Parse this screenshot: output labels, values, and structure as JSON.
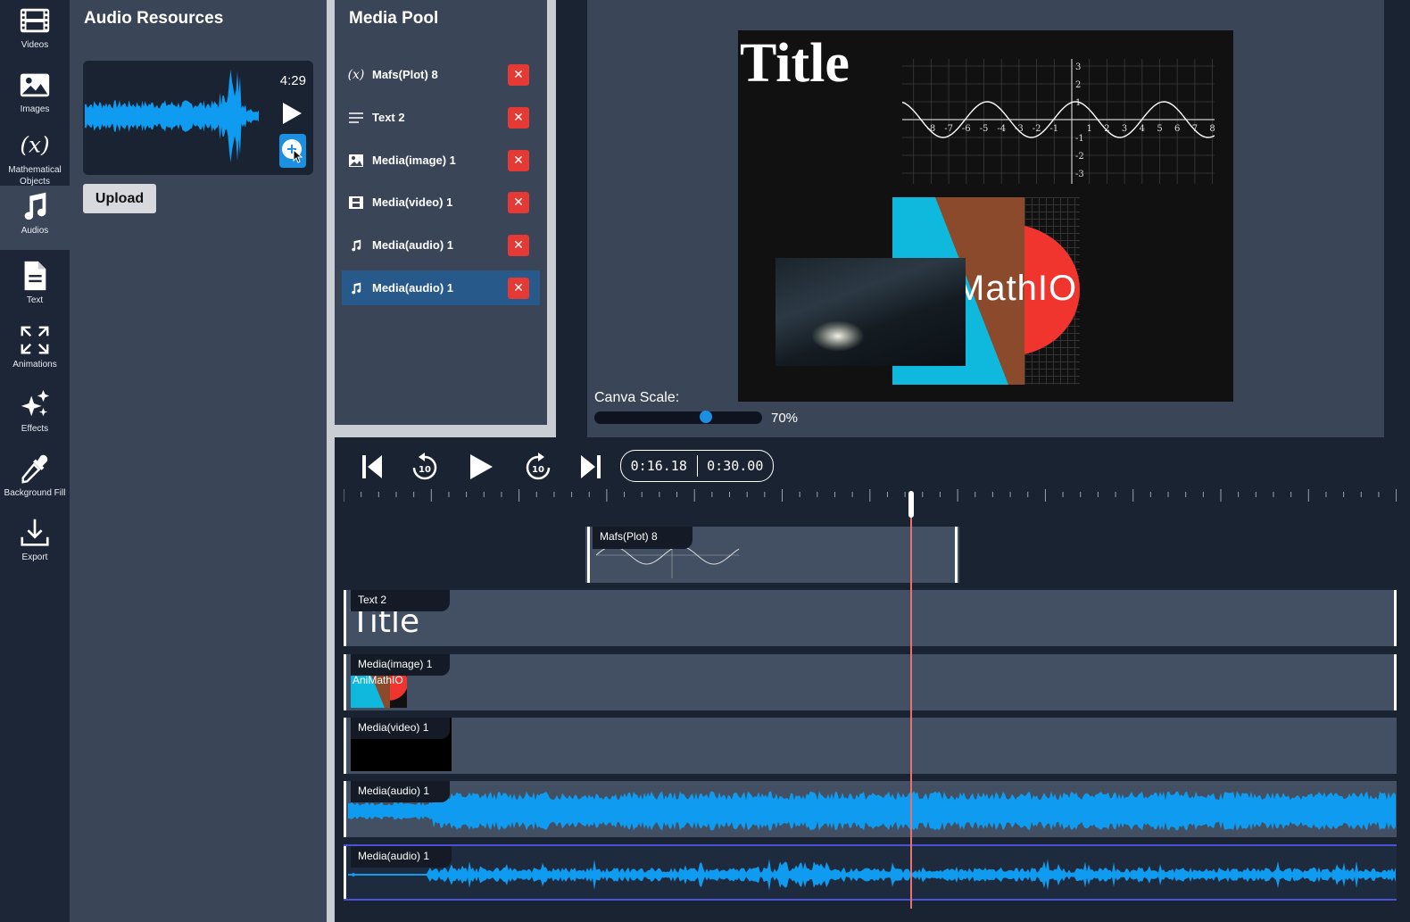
{
  "sidebar": {
    "items": [
      {
        "label": "Videos",
        "icon": "film-icon"
      },
      {
        "label": "Images",
        "icon": "image-icon"
      },
      {
        "label": "Mathematical Objects",
        "icon": "function-icon"
      },
      {
        "label": "Audios",
        "icon": "music-note-icon",
        "active": true
      },
      {
        "label": "Text",
        "icon": "document-icon"
      },
      {
        "label": "Animations",
        "icon": "expand-arrows-icon"
      },
      {
        "label": "Effects",
        "icon": "sparkles-icon"
      },
      {
        "label": "Background Fill",
        "icon": "eyedropper-icon"
      },
      {
        "label": "Export",
        "icon": "download-icon"
      }
    ]
  },
  "audio_resources": {
    "title": "Audio Resources",
    "card": {
      "duration": "4:29"
    },
    "upload_label": "Upload"
  },
  "media_pool": {
    "title": "Media Pool",
    "items": [
      {
        "label": "Mafs(Plot) 8",
        "icon": "function-icon"
      },
      {
        "label": "Text 2",
        "icon": "text-lines-icon"
      },
      {
        "label": "Media(image) 1",
        "icon": "image-icon"
      },
      {
        "label": "Media(video) 1",
        "icon": "film-icon"
      },
      {
        "label": "Media(audio) 1",
        "icon": "music-note-icon"
      },
      {
        "label": "Media(audio) 1",
        "icon": "music-note-icon",
        "selected": true
      }
    ],
    "delete_symbol": "✕"
  },
  "preview": {
    "canvas_title": "Title",
    "plot_x_ticks": [
      "-8",
      "-7",
      "-6",
      "-5",
      "-4",
      "-3",
      "-2",
      "-1",
      "1",
      "2",
      "3",
      "4",
      "5",
      "6",
      "7",
      "8"
    ],
    "plot_y_ticks": [
      "3",
      "2",
      "1",
      "-1",
      "-2",
      "-3"
    ],
    "image_text": "MathIO",
    "scale_label": "Canva Scale:",
    "scale_value": "70%",
    "scale_fraction": 0.7
  },
  "player": {
    "current_time": "0:16.18",
    "total_time": "0:30.00",
    "playhead_fraction": 0.5393
  },
  "timeline": {
    "tracks": [
      {
        "label": "Mafs(Plot) 8",
        "type": "plot"
      },
      {
        "label": "Text 2",
        "type": "text",
        "preview_text": "Title"
      },
      {
        "label": "Media(image) 1",
        "type": "image",
        "preview_text": "AniMathIO"
      },
      {
        "label": "Media(video) 1",
        "type": "video"
      },
      {
        "label": "Media(audio) 1",
        "type": "audio"
      },
      {
        "label": "Media(audio) 1",
        "type": "audio",
        "selected": true
      }
    ]
  },
  "colors": {
    "accent": "#1d8fe0",
    "waveform": "#0e9bf0",
    "delete": "#e53935",
    "playhead": "#e57373",
    "selected": "#275a8a"
  }
}
